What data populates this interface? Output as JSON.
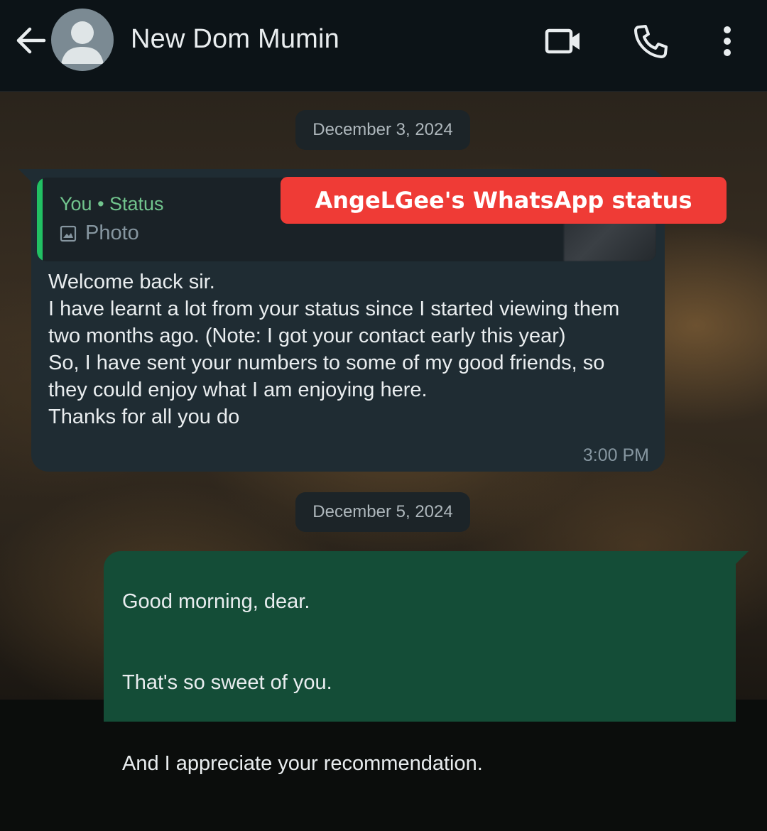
{
  "header": {
    "contact_name": "New Dom Mumin",
    "back_icon": "arrow-left-icon",
    "avatar_icon": "default-avatar-icon",
    "video_icon": "video-call-icon",
    "call_icon": "phone-icon",
    "menu_icon": "more-vertical-icon"
  },
  "overlay": {
    "label": "AngeLGee's WhatsApp status",
    "color": "#ef3b36"
  },
  "chat": {
    "date_1": "December 3, 2024",
    "date_2": "December 5, 2024",
    "incoming": {
      "quote_author": "You • Status",
      "quote_type": "Photo",
      "text": "Welcome back sir.\nI have learnt a lot from your status since I started viewing them two months ago. (Note: I got your contact early this year)\nSo, I have sent your numbers to some of my good friends, so they could enjoy what I am enjoying here.\nThanks for all you do",
      "time": "3:00 PM"
    },
    "outgoing": {
      "line_1": "Good morning, dear.",
      "line_2": "That's so sweet of you.",
      "line_3": "And I appreciate your recommendation."
    }
  },
  "colors": {
    "header_bg": "#0c1317",
    "incoming_bubble": "#1f2c33",
    "outgoing_bubble": "#144d37",
    "accent_green": "#21c063"
  }
}
